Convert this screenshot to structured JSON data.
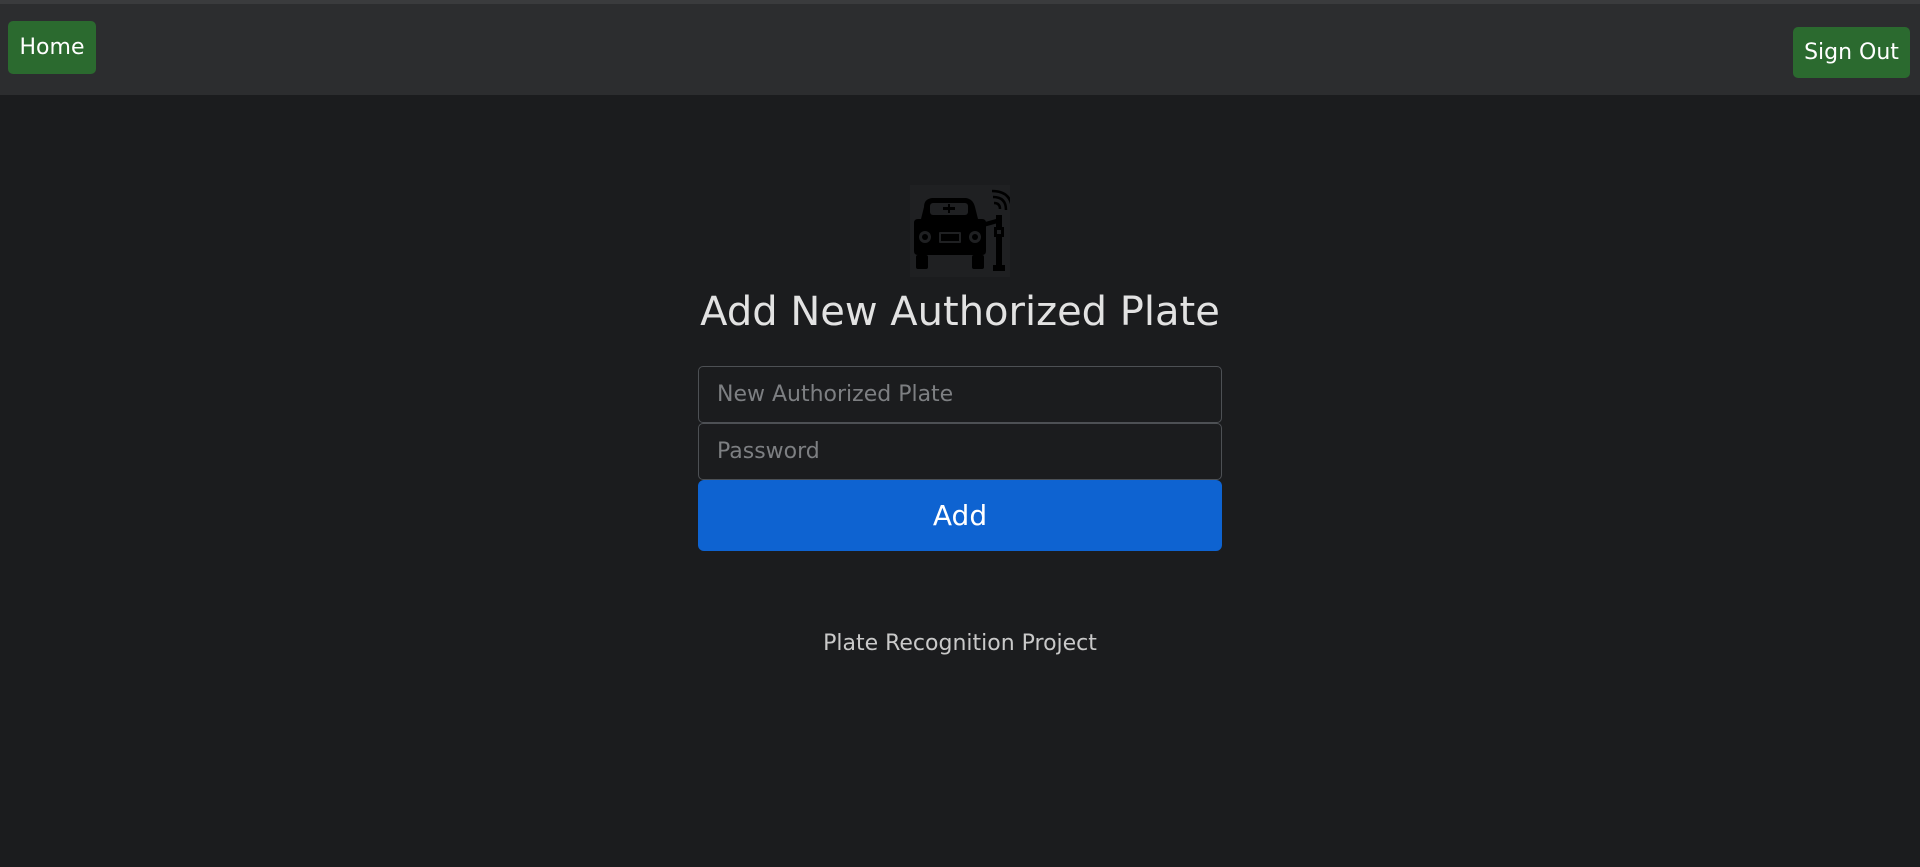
{
  "nav": {
    "home_label": "Home",
    "signout_label": "Sign Out",
    "button_color": "#2b6a2f"
  },
  "logo": {
    "icon": "car-plate-recognition-icon"
  },
  "form": {
    "title": "Add New Authorized Plate",
    "plate_placeholder": "New Authorized Plate",
    "plate_value": "",
    "password_placeholder": "Password",
    "password_value": "",
    "submit_label": "Add",
    "submit_color": "#0e63d1"
  },
  "footer": {
    "text": "Plate Recognition Project"
  },
  "theme": {
    "background": "#1b1c1e",
    "topbar": "#2c2d2f"
  }
}
